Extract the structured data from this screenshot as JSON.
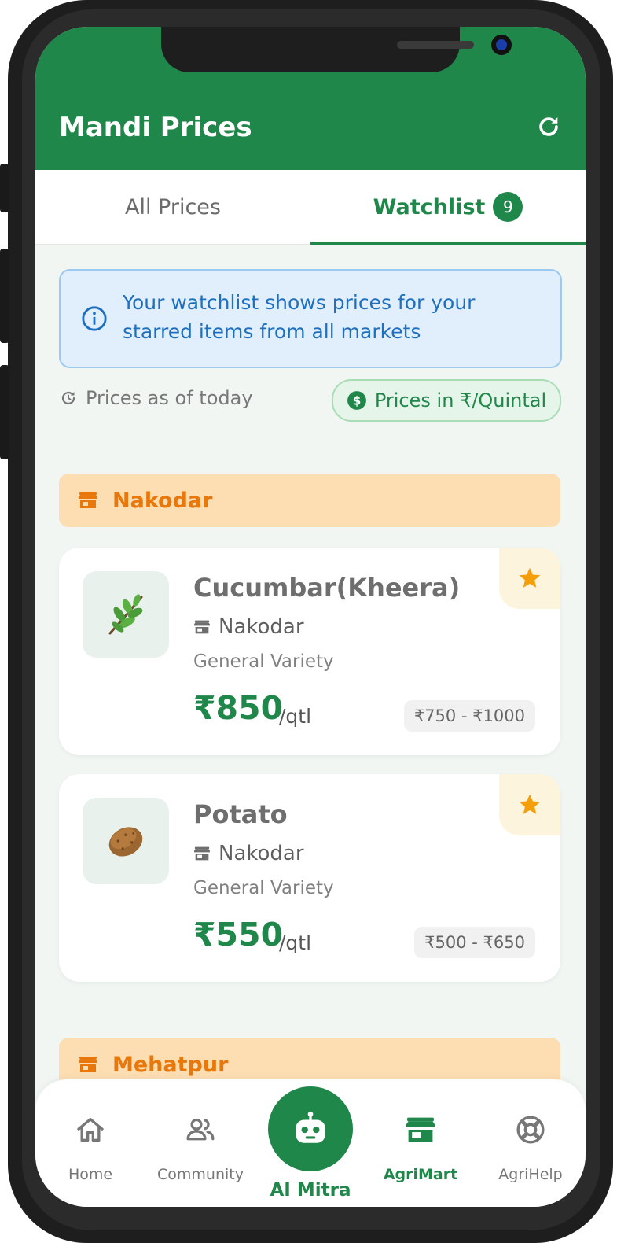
{
  "header": {
    "title": "Mandi Prices"
  },
  "tabs": {
    "all": "All Prices",
    "watchlist": "Watchlist",
    "watchlist_count": "9"
  },
  "info": {
    "text": "Your watchlist shows prices for your starred items from all markets"
  },
  "meta": {
    "as_of": "Prices as of today",
    "unit": "Prices in ₹/Quintal"
  },
  "markets": [
    {
      "name": "Nakodar",
      "items": [
        {
          "name": "Cucumbar(Kheera)",
          "market": "Nakodar",
          "variety": "General Variety",
          "price": "₹850",
          "unit": "/qtl",
          "range": "₹750 - ₹1000",
          "icon": "herb-leaf",
          "starred": true
        },
        {
          "name": "Potato",
          "market": "Nakodar",
          "variety": "General Variety",
          "price": "₹550",
          "unit": "/qtl",
          "range": "₹500 - ₹650",
          "icon": "potato",
          "starred": true
        }
      ]
    },
    {
      "name": "Mehatpur",
      "items": []
    }
  ],
  "nav": {
    "home": "Home",
    "community": "Community",
    "ai_mitra": "AI Mitra",
    "agrimart": "AgriMart",
    "agrihelp": "AgriHelp",
    "active": "agrimart"
  },
  "colors": {
    "primary": "#20874a",
    "market_header_bg": "#fdddb2",
    "market_header_text": "#e8780c",
    "info_bg": "#e1eefb",
    "info_text": "#1f6fbf",
    "star": "#f59e0b"
  }
}
